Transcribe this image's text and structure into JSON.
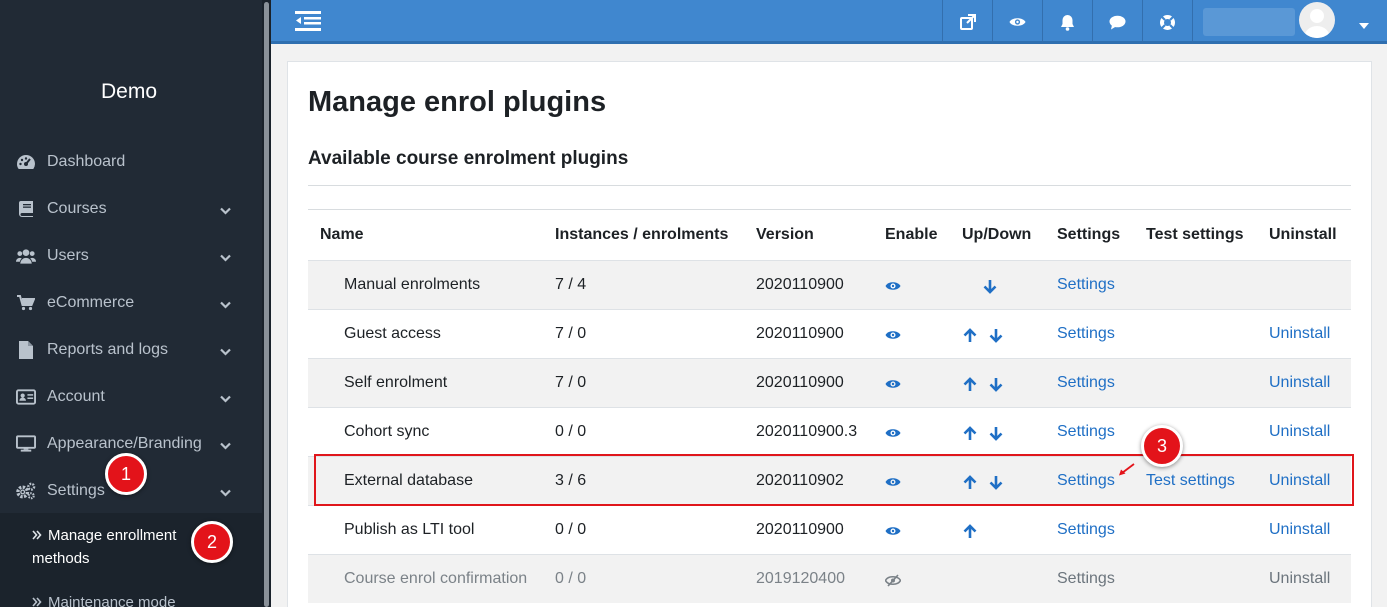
{
  "sidebar": {
    "brand": "Demo",
    "items": [
      {
        "label": "Dashboard",
        "icon": "dashboard-icon",
        "has_chevron": false
      },
      {
        "label": "Courses",
        "icon": "book-icon",
        "has_chevron": true
      },
      {
        "label": "Users",
        "icon": "users-icon",
        "has_chevron": true
      },
      {
        "label": "eCommerce",
        "icon": "cart-icon",
        "has_chevron": true
      },
      {
        "label": "Reports and logs",
        "icon": "file-icon",
        "has_chevron": true
      },
      {
        "label": "Account",
        "icon": "id-card-icon",
        "has_chevron": true
      },
      {
        "label": "Appearance/Branding",
        "icon": "monitor-icon",
        "has_chevron": true
      },
      {
        "label": "Settings",
        "icon": "gears-icon",
        "has_chevron": true
      }
    ],
    "submenu": [
      {
        "label": "Manage enrollment methods"
      },
      {
        "label": "Maintenance mode"
      }
    ]
  },
  "topbar": {
    "buttons": [
      "external-link-icon",
      "eye-icon",
      "bell-icon",
      "chat-icon",
      "lifebuoy-icon"
    ]
  },
  "page": {
    "title": "Manage enrol plugins",
    "section": "Available course enrolment plugins"
  },
  "table": {
    "headers": {
      "name": "Name",
      "instances": "Instances / enrolments",
      "version": "Version",
      "enable": "Enable",
      "updown": "Up/Down",
      "settings": "Settings",
      "test": "Test settings",
      "uninstall": "Uninstall"
    },
    "rows": [
      {
        "name": "Manual enrolments",
        "instances": "7 / 4",
        "version": "2020110900",
        "settings": "Settings",
        "test": "",
        "uninstall": ""
      },
      {
        "name": "Guest access",
        "instances": "7 / 0",
        "version": "2020110900",
        "settings": "Settings",
        "test": "",
        "uninstall": "Uninstall"
      },
      {
        "name": "Self enrolment",
        "instances": "7 / 0",
        "version": "2020110900",
        "settings": "Settings",
        "test": "",
        "uninstall": "Uninstall"
      },
      {
        "name": "Cohort sync",
        "instances": "0 / 0",
        "version": "2020110900.3",
        "settings": "Settings",
        "test": "",
        "uninstall": "Uninstall"
      },
      {
        "name": "External database",
        "instances": "3 / 6",
        "version": "2020110902",
        "settings": "Settings",
        "test": "Test settings",
        "uninstall": "Uninstall"
      },
      {
        "name": "Publish as LTI tool",
        "instances": "0 / 0",
        "version": "2020110900",
        "settings": "Settings",
        "test": "",
        "uninstall": "Uninstall"
      },
      {
        "name": "Course enrol confirmation",
        "instances": "0 / 0",
        "version": "2019120400",
        "settings": "Settings",
        "test": "",
        "uninstall": "Uninstall"
      }
    ]
  },
  "annotations": {
    "markers": [
      "1",
      "2",
      "3"
    ],
    "color": "#e3131a"
  },
  "colors": {
    "sidebar_bg": "#212a35",
    "topbar_bg": "#4087cf",
    "link": "#1f6fc5"
  }
}
